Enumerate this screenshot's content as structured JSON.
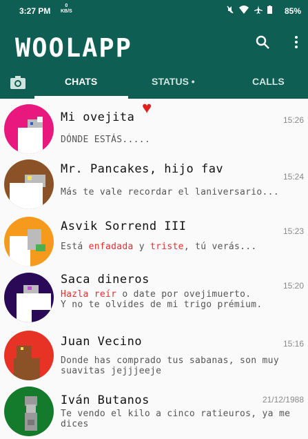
{
  "status_bar": {
    "time": "3:27 PM",
    "speed": "0\nKB/S",
    "battery": "85%"
  },
  "app": {
    "title": "WOOLAPP"
  },
  "tabs": {
    "chats": "CHATS",
    "status": "STATUS •",
    "calls": "CALLS"
  },
  "colors": {
    "header": "#0f5e54",
    "accent_red": "#e3302f"
  },
  "chats": [
    {
      "name": "Mi ovejita",
      "time": "15:26",
      "message": "DÓNDE ESTÁS.....",
      "avatar_bg": "#e8187f",
      "heart": "♥"
    },
    {
      "name": "Mr. Pancakes, hijo fav",
      "time": "15:24",
      "message": "Más te vale recordar el laniversario...",
      "avatar_bg": "#8a5226"
    },
    {
      "name": "Asvik Sorrend III",
      "time": "15:23",
      "message_parts": [
        "Está ",
        "enfadada",
        " y ",
        "triste",
        ", tú verás..."
      ],
      "avatar_bg": "#f59a1c"
    },
    {
      "name": "Saca dineros",
      "time": "15:20",
      "message_parts": [
        "Hazla reír",
        " o date por ovejimuerto."
      ],
      "message_line2": "Y no te olvides de mi trigo prémium.",
      "avatar_bg": "#2a0a57"
    },
    {
      "name": "Juan Vecino",
      "time": "15:16",
      "message": "Donde has comprado tus sabanas, son muy suavitas jejjjeeje",
      "avatar_bg": "#e63326"
    },
    {
      "name": "Iván Butanos",
      "time": "21/12/1988",
      "message": "Te vendo el kilo a cinco ratieuros, ya me dices",
      "avatar_bg": "#147a2c"
    }
  ]
}
